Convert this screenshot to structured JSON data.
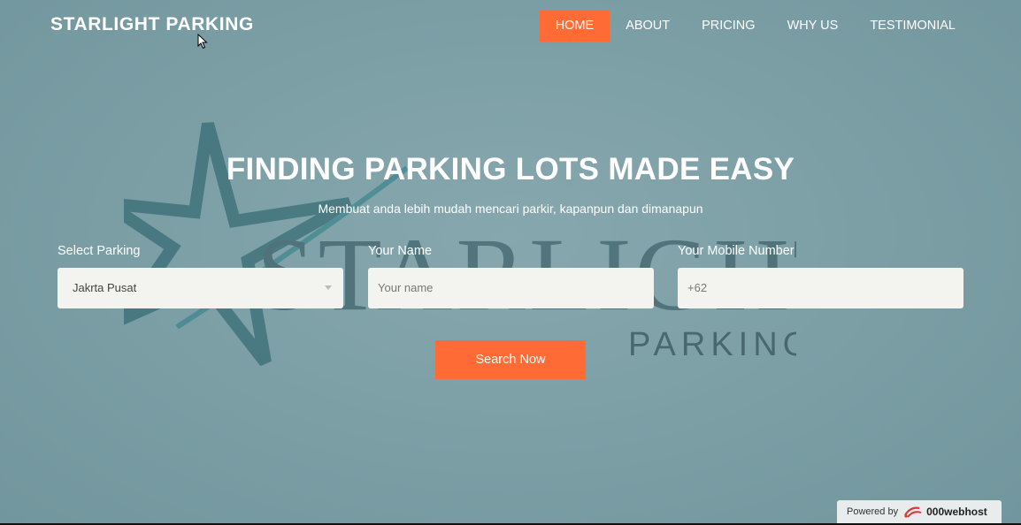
{
  "brand": "STARLIGHT PARKING",
  "nav": [
    {
      "label": "HOME",
      "active": true
    },
    {
      "label": "ABOUT"
    },
    {
      "label": "PRICING"
    },
    {
      "label": "WHY US"
    },
    {
      "label": "TESTIMONIAL"
    }
  ],
  "hero": {
    "title": "FINDING PARKING LOTS MADE EASY",
    "subtitle": "Membuat anda lebih mudah mencari parkir, kapanpun dan dimanapun"
  },
  "form": {
    "parking_label": "Select Parking",
    "parking_value": "Jakrta Pusat",
    "name_label": "Your Name",
    "name_placeholder": "Your name",
    "mobile_label": "Your Mobile Number",
    "mobile_value": "+62",
    "search_label": "Search Now"
  },
  "watermark": {
    "word1": "STARLIGHT",
    "word2": "PARKING"
  },
  "powered": {
    "prefix": "Powered by",
    "host": "000webhost"
  },
  "colors": {
    "accent": "#ff6b35",
    "background": "#7a9ca3"
  }
}
